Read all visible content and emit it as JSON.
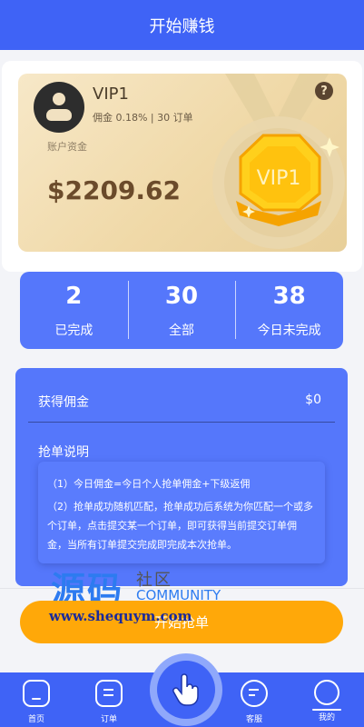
{
  "header": {
    "title": "开始赚钱"
  },
  "vip_card": {
    "level_name": "VIP1",
    "detail": "佣金 0.18% | 30 订单",
    "account_label": "账户资金",
    "balance": "$2209.62",
    "badge_text": "VIP1",
    "help_glyph": "?"
  },
  "stats": [
    {
      "value": "2",
      "label": "已完成"
    },
    {
      "value": "30",
      "label": "全部"
    },
    {
      "value": "38",
      "label": "今日未完成"
    }
  ],
  "commission": {
    "label": "获得佣金",
    "value": "$0"
  },
  "rules": {
    "title": "抢单说明",
    "items": [
      "（1）今日佣金=今日个人抢单佣金+下级返佣",
      "（2）抢单成功随机匹配，抢单成功后系统为你匹配一个或多个订单，点击提交某一个订单，即可获得当前提交订单佣金，当所有订单提交完成即完成本次抢单。"
    ]
  },
  "start_button": {
    "label": "开始抢单"
  },
  "watermark": {
    "big": "源码",
    "cn": "社区",
    "en": "COMMUNITY",
    "url": "www.shequym.com"
  },
  "tabbar": {
    "items": [
      {
        "label": "首页",
        "icon": "home-icon"
      },
      {
        "label": "订单",
        "icon": "order-icon"
      },
      {
        "label": "",
        "icon": "tap-hand-icon"
      },
      {
        "label": "客服",
        "icon": "chat-icon"
      },
      {
        "label": "我的",
        "icon": "profile-icon"
      }
    ]
  },
  "colors": {
    "primary": "#3f63f6",
    "panel": "#5577fb",
    "accent": "#ffa809",
    "gold": "#f0d9a8"
  }
}
